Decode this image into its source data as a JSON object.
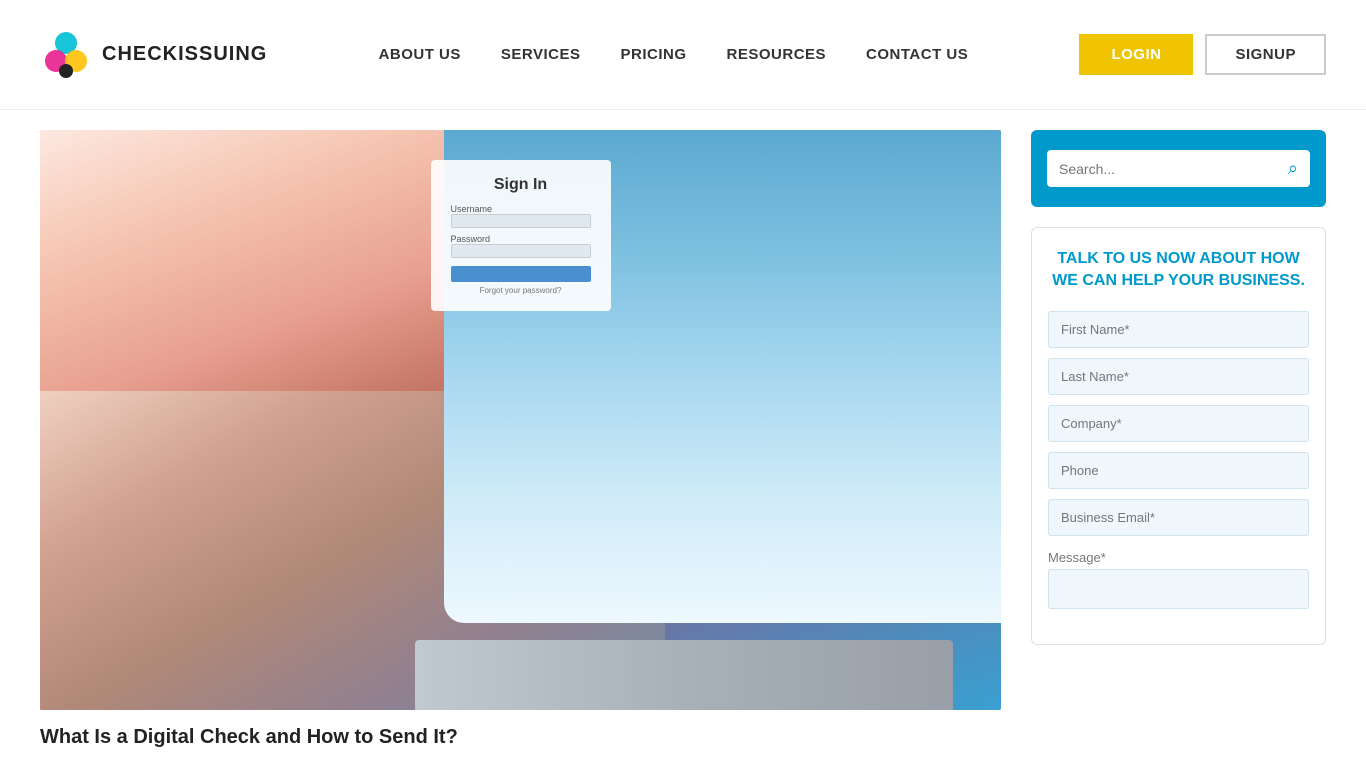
{
  "header": {
    "logo_text": "CHECKISSUING",
    "nav_items": [
      {
        "label": "ABOUT US",
        "id": "about-us"
      },
      {
        "label": "SERVICES",
        "id": "services"
      },
      {
        "label": "PRICING",
        "id": "pricing"
      },
      {
        "label": "RESOURCES",
        "id": "resources"
      },
      {
        "label": "CONTACT US",
        "id": "contact-us"
      }
    ],
    "login_label": "LOGIN",
    "signup_label": "SIGNUP"
  },
  "search": {
    "placeholder": "Search..."
  },
  "sidebar": {
    "form_title": "TALK TO US NOW ABOUT HOW WE CAN HELP YOUR BUSINESS.",
    "fields": [
      {
        "placeholder": "First Name*",
        "id": "first-name",
        "type": "text"
      },
      {
        "placeholder": "Last Name*",
        "id": "last-name",
        "type": "text"
      },
      {
        "placeholder": "Company*",
        "id": "company",
        "type": "text"
      },
      {
        "placeholder": "Phone",
        "id": "phone",
        "type": "text"
      },
      {
        "placeholder": "Business Email*",
        "id": "business-email",
        "type": "email"
      }
    ],
    "message_label": "Message*"
  },
  "article": {
    "title": "What Is a Digital Check and How to Send It?"
  },
  "colors": {
    "accent_blue": "#0099cc",
    "login_yellow": "#f0c400",
    "field_bg": "#f0f7fc"
  }
}
